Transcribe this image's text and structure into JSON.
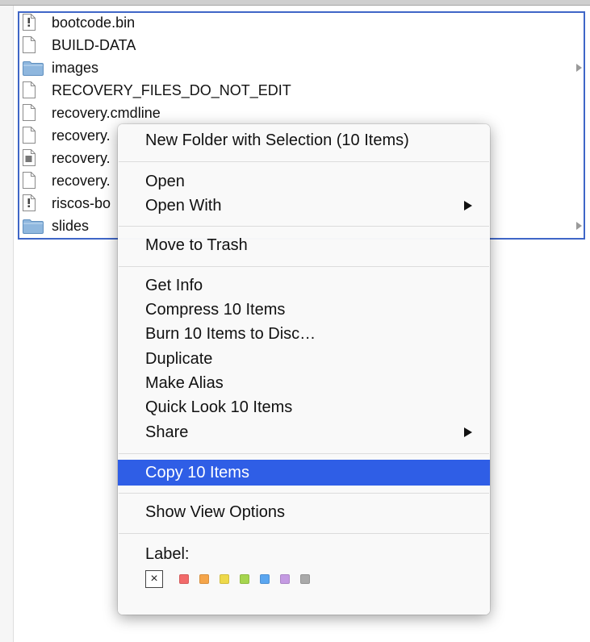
{
  "files": [
    {
      "name": "bootcode.bin",
      "icon": "exec-file-icon",
      "folder": false
    },
    {
      "name": "BUILD-DATA",
      "icon": "document-icon",
      "folder": false
    },
    {
      "name": "images",
      "icon": "folder-icon",
      "folder": true
    },
    {
      "name": "RECOVERY_FILES_DO_NOT_EDIT",
      "icon": "document-icon",
      "folder": false
    },
    {
      "name": "recovery.cmdline",
      "icon": "document-icon",
      "folder": false
    },
    {
      "name": "recovery.",
      "icon": "document-icon",
      "folder": false
    },
    {
      "name": "recovery.",
      "icon": "text-file-icon",
      "folder": false
    },
    {
      "name": "recovery.",
      "icon": "document-icon",
      "folder": false
    },
    {
      "name": "riscos-bo",
      "icon": "exec-file-icon",
      "folder": false
    },
    {
      "name": "slides",
      "icon": "folder-icon",
      "folder": true
    }
  ],
  "menu": {
    "new_folder": "New Folder with Selection (10 Items)",
    "open": "Open",
    "open_with": "Open With",
    "move_to_trash": "Move to Trash",
    "get_info": "Get Info",
    "compress": "Compress 10 Items",
    "burn": "Burn 10 Items to Disc…",
    "duplicate": "Duplicate",
    "make_alias": "Make Alias",
    "quick_look": "Quick Look 10 Items",
    "share": "Share",
    "copy": "Copy 10 Items",
    "show_view_options": "Show View Options",
    "label_heading": "Label:",
    "no_label_glyph": "×",
    "highlighted_item": "copy"
  },
  "label_colors": [
    {
      "name": "red",
      "hex": "#f26a6a"
    },
    {
      "name": "orange",
      "hex": "#f5a54a"
    },
    {
      "name": "yellow",
      "hex": "#eed94a"
    },
    {
      "name": "green",
      "hex": "#a6d54e"
    },
    {
      "name": "blue",
      "hex": "#5aa6f0"
    },
    {
      "name": "purple",
      "hex": "#c49ae2"
    },
    {
      "name": "gray",
      "hex": "#a9a9a9"
    }
  ],
  "colors": {
    "selection_outline": "#3f66c7",
    "menu_highlight": "#2f5ee6",
    "folder_blue": "#8fb7de"
  }
}
